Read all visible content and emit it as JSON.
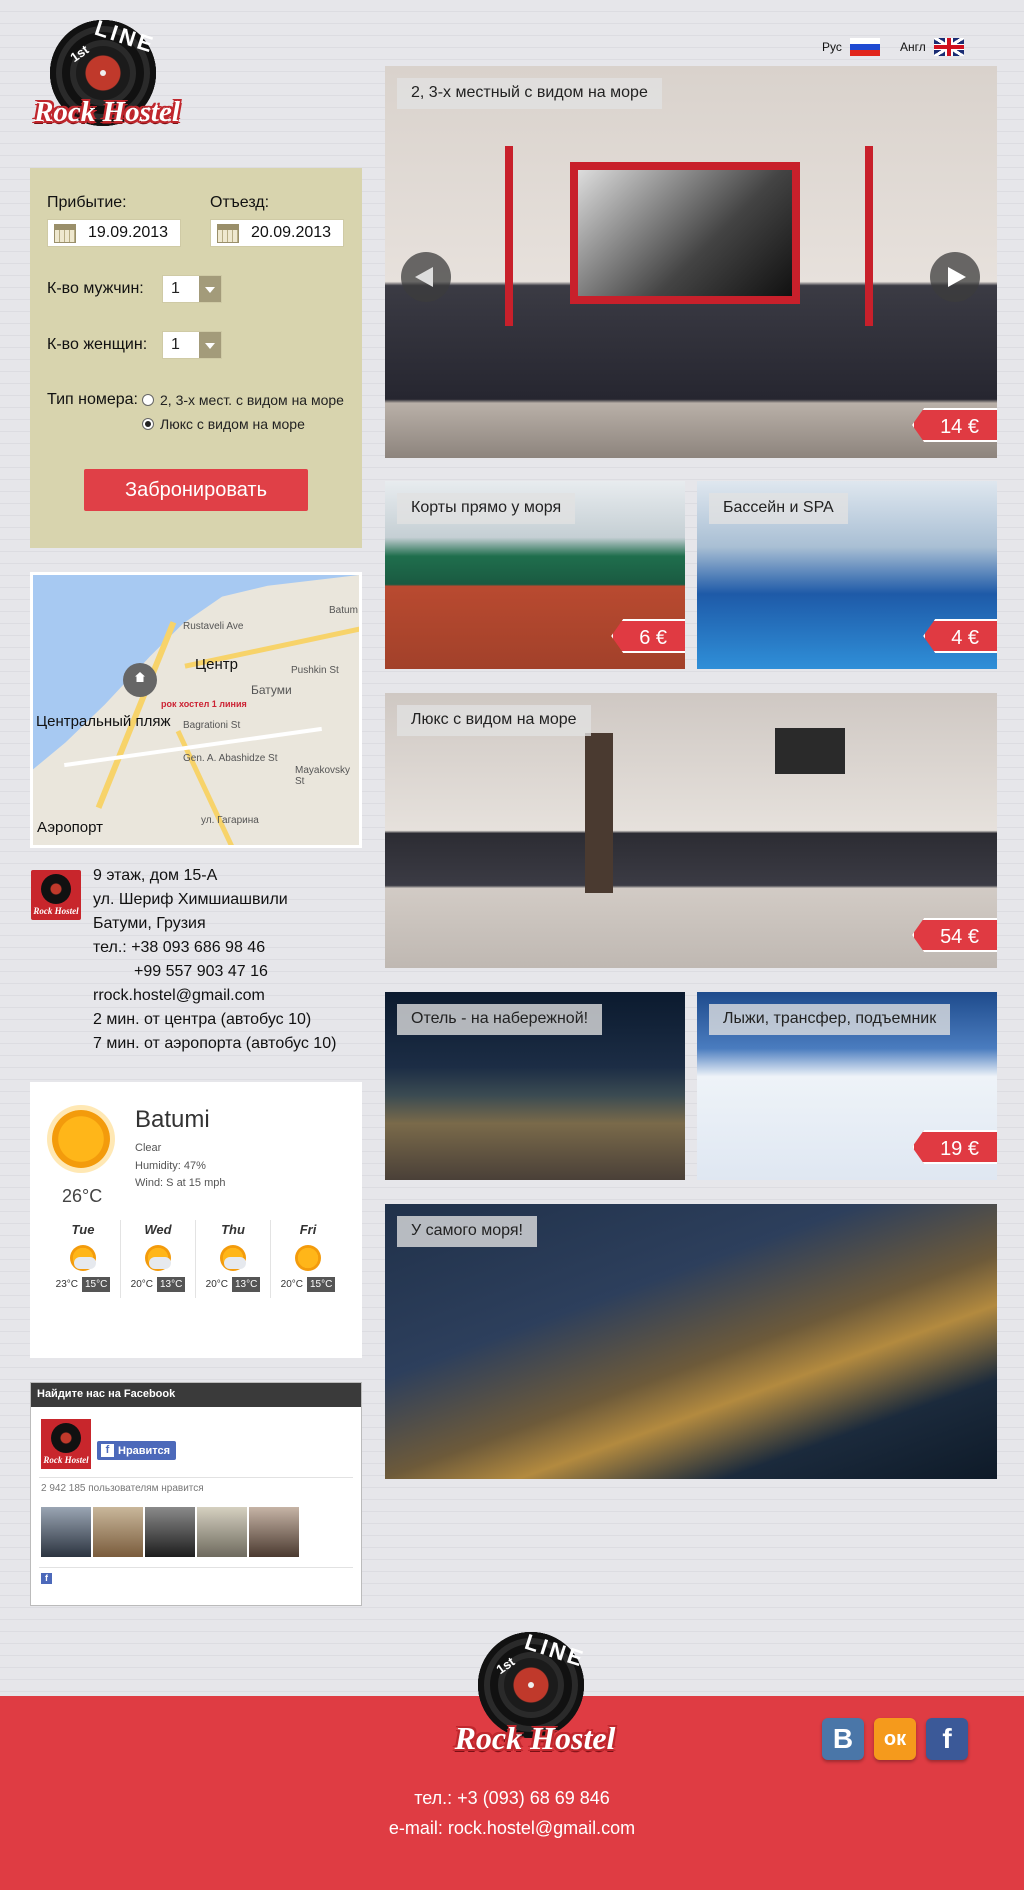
{
  "brand": {
    "logo_line": "LINE",
    "logo_1st": "1st",
    "logo_text": "Rock Hostel"
  },
  "lang": {
    "ru": "Рус",
    "en": "Англ"
  },
  "booking": {
    "arrival_label": "Прибытие:",
    "arrival_value": "19.09.2013",
    "departure_label": "Отъезд:",
    "departure_value": "20.09.2013",
    "men_label": "К-во мужчин:",
    "men_value": "1",
    "women_label": "К-во женщин:",
    "women_value": "1",
    "room_type_label": "Тип номера:",
    "room_options": [
      "2, 3-х мест. с видом на море",
      "Люкс с видом на море"
    ],
    "selected_room": 1,
    "button": "Забронировать"
  },
  "map": {
    "labels": {
      "center": "Центр",
      "beach": "Центральный пляж",
      "airport": "Аэропорт",
      "batumi": "Батуми",
      "hostel": "рок хостел 1 линия"
    },
    "streets": [
      "Rustaveli Ave",
      "Pushkin St",
      "Bagrationi St",
      "Gen. A. Abashidze St",
      "Mayakovsky St",
      "ул. Гагарина",
      "Batum"
    ]
  },
  "address": {
    "lines": [
      "9 этаж, дом 15-А",
      "ул. Шериф Химшиашвили",
      "Батуми, Грузия",
      "тел.: +38 093 686 98 46",
      "+99 557 903 47 16",
      "rrock.hostel@gmail.com",
      "2 мин. от центра (автобус 10)",
      "7 мин. от аэропорта (автобус 10)"
    ]
  },
  "weather": {
    "city": "Batumi",
    "condition": "Clear",
    "humidity": "Humidity: 47%",
    "wind": "Wind: S at 15 mph",
    "temp": "26°C",
    "days": [
      {
        "name": "Tue",
        "hi": "23°C",
        "lo": "15°C",
        "icon": "partly-cloudy-icon"
      },
      {
        "name": "Wed",
        "hi": "20°C",
        "lo": "13°C",
        "icon": "partly-cloudy-icon"
      },
      {
        "name": "Thu",
        "hi": "20°C",
        "lo": "13°C",
        "icon": "partly-cloudy-icon"
      },
      {
        "name": "Fri",
        "hi": "20°C",
        "lo": "15°C",
        "icon": "sun-icon"
      }
    ]
  },
  "facebook": {
    "title": "Найдите нас на Facebook",
    "like": "Нравится",
    "count": "2 942 185 пользователям нравится"
  },
  "slider": {
    "caption": "2, 3-х местный с видом на море",
    "price": "14 €"
  },
  "tiles": [
    {
      "caption": "Корты прямо у моря",
      "price": "6 €"
    },
    {
      "caption": "Бассейн и SPA",
      "price": "4 €"
    },
    {
      "caption": "Люкс с видом на море",
      "price": "54 €"
    },
    {
      "caption": "Отель - на набережной!",
      "price": ""
    },
    {
      "caption": "Лыжи, трансфер, подъемник",
      "price": "19 €"
    },
    {
      "caption": "У самого моря!",
      "price": ""
    }
  ],
  "footer": {
    "phone": "тел.: +3 (093) 68 69 846",
    "email": "e-mail: rock.hostel@gmail.com",
    "social": [
      "В",
      "ок",
      "f"
    ]
  },
  "colors": {
    "accent": "#df3c43",
    "booking_bg": "#d8d4ae",
    "page_bg": "#e6e6ea"
  }
}
